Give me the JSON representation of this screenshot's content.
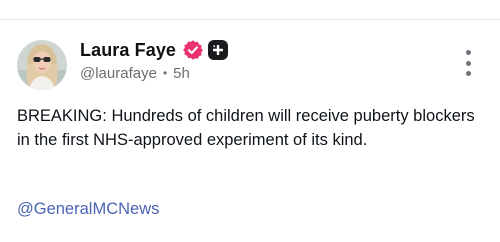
{
  "post": {
    "author": {
      "display_name": "Laura Faye",
      "handle": "@laurafaye",
      "separator": "•",
      "time_ago": "5h",
      "avatar_icon": "profile-photo",
      "verified_icon": "verified-badge-icon",
      "plus_icon": "plus-badge-icon"
    },
    "body": "BREAKING: Hundreds of children will receive puberty blockers in the first NHS-approved experiment of its kind.",
    "mention": "@GeneralMCNews",
    "menu_icon": "more-vertical-icon"
  },
  "colors": {
    "verified": "#e8336e",
    "plus_badge": "#1b1b1f",
    "mention_link": "#4a64b4",
    "muted_text": "#6a6f74",
    "divider": "#e6e8ea"
  }
}
